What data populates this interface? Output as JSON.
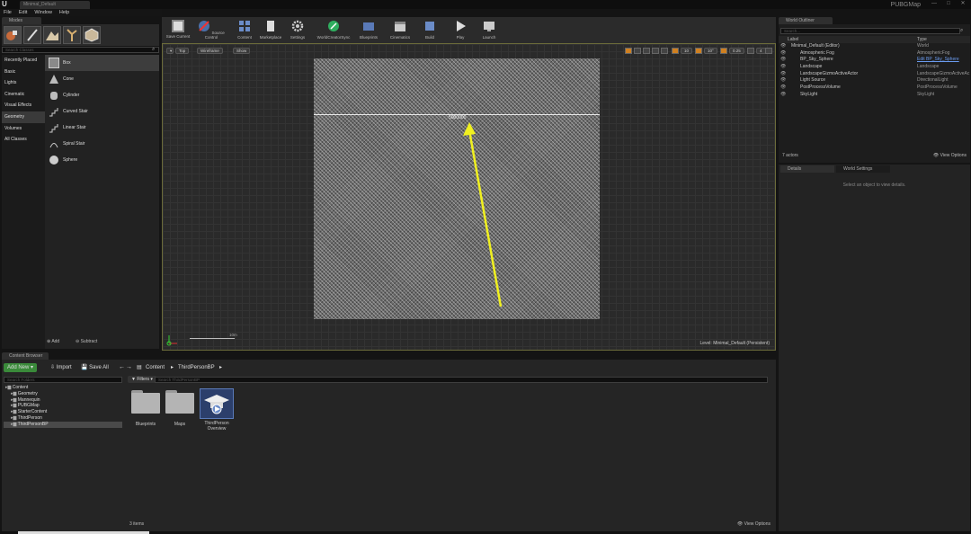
{
  "window": {
    "doc_tab": "Minimal_Default",
    "app_title": "PUBGMap",
    "controls": [
      "—",
      "□",
      "✕"
    ]
  },
  "menu": [
    "File",
    "Edit",
    "Window",
    "Help"
  ],
  "modes": {
    "tab_label": "Modes",
    "search_placeholder": "Search Classes",
    "categories": [
      "Recently Placed",
      "Basic",
      "Lights",
      "Cinematic",
      "Visual Effects",
      "Geometry",
      "Volumes",
      "All Classes"
    ],
    "selected_category": "Geometry",
    "items": [
      "Box",
      "Cone",
      "Cylinder",
      "Curved Stair",
      "Linear Stair",
      "Spiral Stair",
      "Sphere"
    ],
    "footer": {
      "add": "Add",
      "subtract": "Subtract"
    }
  },
  "toolbar": {
    "buttons": [
      "Save Current",
      "Source Control",
      "Content",
      "Marketplace",
      "Settings",
      "WorldCreatorSync",
      "Blueprints",
      "Cinematics",
      "Build",
      "Play",
      "Launch"
    ]
  },
  "viewport": {
    "view_mode": "Top",
    "render_mode": "Wireframe",
    "show_label": "Show",
    "snap_values": [
      "10",
      "10°",
      "0.25"
    ],
    "camera_speed": "4",
    "terrain_label": "5000000",
    "scale_label": "10m",
    "level_text": "Level:  Minimal_Default (Persistent)",
    "arrow_color": "#f0f020"
  },
  "outliner": {
    "tab_label": "World Outliner",
    "search_placeholder": "Search...",
    "columns": [
      "Label",
      "Type"
    ],
    "rows": [
      {
        "label": "Minimal_Default (Editor)",
        "type": "World"
      },
      {
        "label": "Atmospheric Fog",
        "type": "AtmosphericFog"
      },
      {
        "label": "BP_Sky_Sphere",
        "type": "Edit BP_Sky_Sphere"
      },
      {
        "label": "Landscape",
        "type": "Landscape"
      },
      {
        "label": "LandscapeGizmoActiveActor",
        "type": "LandscapeGizmoActiveAc"
      },
      {
        "label": "Light Source",
        "type": "DirectionalLight"
      },
      {
        "label": "PostProcessVolume",
        "type": "PostProcessVolume"
      },
      {
        "label": "SkyLight",
        "type": "SkyLight"
      }
    ],
    "actor_count": "7 actors",
    "view_options": "View Options"
  },
  "details": {
    "tabs": [
      "Details",
      "World Settings"
    ],
    "empty_text": "Select an object to view details."
  },
  "content_browser": {
    "tab_label": "Content Browser",
    "add_new": "Add New",
    "import": "Import",
    "save_all": "Save All",
    "breadcrumb": [
      "Content",
      "ThirdPersonBP"
    ],
    "filters": "Filters",
    "search_placeholder": "Search ThirdPersonBP",
    "folder_search_placeholder": "Search Folders",
    "tree": [
      "Content",
      "Geometry",
      "Mannequin",
      "PUBGMap",
      "StarterContent",
      "ThirdPerson",
      "ThirdPersonBP"
    ],
    "assets": [
      "Blueprints",
      "Maps",
      "ThirdPerson Overview"
    ],
    "item_count": "3 items",
    "view_options": "View Options"
  }
}
